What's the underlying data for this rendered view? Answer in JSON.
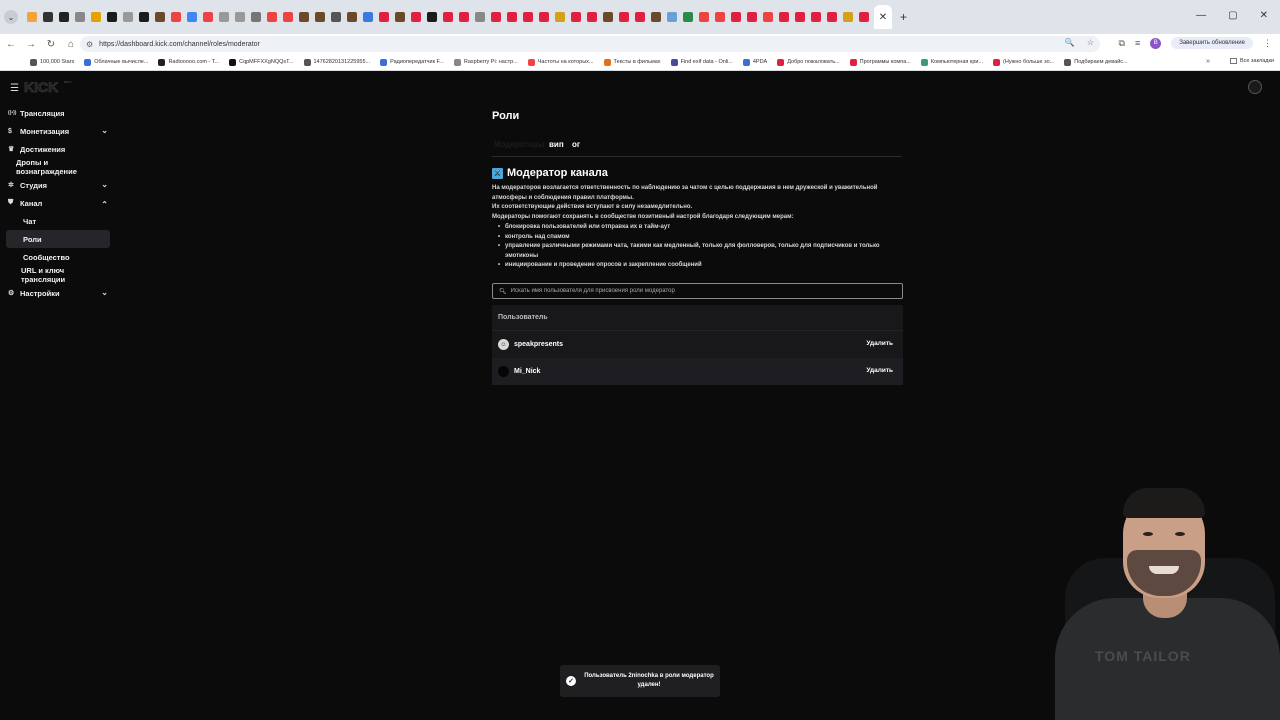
{
  "browser": {
    "url": "https://dashboard.kick.com/channel/roles/moderator",
    "update_label": "Завершить обновление",
    "profile_initial": "B",
    "tab_favicon_colors": [
      "#f2a33a",
      "#333",
      "#222",
      "#888",
      "#e5a100",
      "#1b1b1b",
      "#999",
      "#1b1b1b",
      "#6b4a2a",
      "#e44",
      "#4285f4",
      "#e44",
      "#999",
      "#999",
      "#777",
      "#e44",
      "#e44",
      "#6b4a2a",
      "#6b4a2a",
      "#555",
      "#6b4a2a",
      "#3b7be0",
      "#e02040",
      "#6b4a2a",
      "#e02040",
      "#1b1b1b",
      "#e02040",
      "#e02040",
      "#888",
      "#e02040",
      "#e02040",
      "#e02040",
      "#e02040",
      "#d4a017",
      "#e02040",
      "#e02040",
      "#6b4a2a",
      "#e02040",
      "#e02040",
      "#6b4a2a",
      "#6a9fd8",
      "#2a8a4a",
      "#e44",
      "#e44",
      "#e02040",
      "#e02040",
      "#e44",
      "#e02040",
      "#e02040",
      "#e02040",
      "#e02040",
      "#d4a017",
      "#e02040"
    ],
    "bookmarks": [
      {
        "label": "100,000 Stars",
        "color": "#555"
      },
      {
        "label": "Облачные вычисле...",
        "color": "#3a6fd8"
      },
      {
        "label": "Radiooooo.com - T...",
        "color": "#222"
      },
      {
        "label": "CqpMFFXXgNQQsT...",
        "color": "#111"
      },
      {
        "label": "14762820131225955...",
        "color": "#555"
      },
      {
        "label": "Радиопередатчик F...",
        "color": "#3a6fd8"
      },
      {
        "label": "Raspberry Pi: настр...",
        "color": "#888"
      },
      {
        "label": "Частоты на которых...",
        "color": "#e44"
      },
      {
        "label": "Тексты в фильмах",
        "color": "#e07020"
      },
      {
        "label": "Find exif data - Onli...",
        "color": "#4a4a9a"
      },
      {
        "label": "4PDA",
        "color": "#3a6fd8"
      },
      {
        "label": "Добро пожаловать...",
        "color": "#e02040"
      },
      {
        "label": "Программы компа...",
        "color": "#e02040"
      },
      {
        "label": "Компьютерная кри...",
        "color": "#3a9a7a"
      },
      {
        "label": "(Нужно больше зо...",
        "color": "#e02040"
      },
      {
        "label": "Подбираем девайс...",
        "color": "#555"
      }
    ],
    "all_bookmarks_label": "Все закладки"
  },
  "app": {
    "logo": "KICK",
    "logo_badge": "BETA"
  },
  "sidebar": {
    "items": [
      {
        "label": "Трансляция",
        "icon": "broadcast-icon",
        "glyph": "((•))",
        "chevron": ""
      },
      {
        "label": "Монетизация",
        "icon": "dollar-icon",
        "glyph": "$",
        "chevron": "⌄"
      },
      {
        "label": "Достижения",
        "icon": "trophy-icon",
        "glyph": "🏆",
        "chevron": ""
      },
      {
        "label": "Дропы и вознаграждение",
        "icon": "",
        "glyph": "",
        "chevron": ""
      },
      {
        "label": "Студия",
        "icon": "studio-icon",
        "glyph": "✲",
        "chevron": "⌄"
      },
      {
        "label": "Канал",
        "icon": "channel-icon",
        "glyph": "⛊",
        "chevron": "⌃"
      },
      {
        "label": "Чат",
        "icon": "",
        "glyph": "",
        "chevron": ""
      },
      {
        "label": "Роли",
        "icon": "",
        "glyph": "",
        "chevron": ""
      },
      {
        "label": "Сообщество",
        "icon": "",
        "glyph": "",
        "chevron": ""
      },
      {
        "label": "URL и ключ трансляции",
        "icon": "",
        "glyph": "",
        "chevron": ""
      },
      {
        "label": "Настройки",
        "icon": "gear-icon",
        "glyph": "⚙",
        "chevron": "⌄"
      }
    ]
  },
  "main": {
    "page_title": "Роли",
    "tabs": [
      {
        "label": "Модераторы"
      },
      {
        "label": "вип"
      },
      {
        "label": "ог"
      }
    ],
    "role_title": "Модератор канала",
    "description": [
      "На модераторов возлагается ответственность по наблюдению за чатом с целью поддержания в нем дружеской и уважительной атмосферы и соблюдения правил платформы.",
      "Их соответствующие действия вступают в силу незамедлительно.",
      "Модераторы помогают сохранять в сообществе позитивный настрой благодаря следующим мерам:"
    ],
    "bullets": [
      "блокировка пользователей или отправка их в тайм-аут",
      "контроль над спамом",
      "управление различными режимами чата, такими как медленный, только для фолловеров, только для подписчиков и только эмотиконы",
      "инициирование и проведение опросов и закрепление сообщений"
    ],
    "search_placeholder": "Искать имя пользователя для присвоения роли модератор",
    "table": {
      "header": "Пользователь",
      "rows": [
        {
          "username": "speakpresents",
          "action": "Удалить",
          "avatar_color": "#d8d8d8"
        },
        {
          "username": "Mi_Nick",
          "action": "Удалить",
          "avatar_color": "#050505"
        }
      ]
    }
  },
  "toast": {
    "message": "Пользователь 2ninochka в роли модератор удален!"
  },
  "webcam": {
    "shirt_text": "TOM TAILOR"
  }
}
